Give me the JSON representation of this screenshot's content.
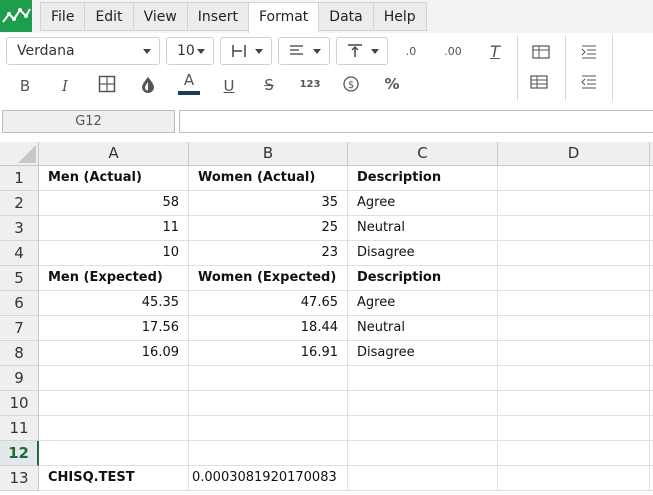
{
  "menu": [
    "File",
    "Edit",
    "View",
    "Insert",
    "Format",
    "Data",
    "Help"
  ],
  "active_menu": "Format",
  "toolbar": {
    "font_name": "Verdana",
    "font_size": "10",
    "bold_label": "B",
    "italic_label": "I",
    "text_color_label": "A",
    "underline_label": "U",
    "strike_label": "S",
    "number_format_label": "123",
    "percent_label": "%",
    "clear_format_label": "T",
    "decrease_decimal_label": ".0",
    "increase_decimal_label": ".00"
  },
  "name_box": "G12",
  "formula": "",
  "columns": [
    "A",
    "B",
    "C",
    "D"
  ],
  "rows": [
    "1",
    "2",
    "3",
    "4",
    "5",
    "6",
    "7",
    "8",
    "9",
    "10",
    "11",
    "12",
    "13"
  ],
  "selected_row": "12",
  "cells": {
    "A1": "Men (Actual)",
    "B1": "Women (Actual)",
    "C1": "Description",
    "A2": "58",
    "B2": "35",
    "C2": "Agree",
    "A3": "11",
    "B3": "25",
    "C3": "Neutral",
    "A4": "10",
    "B4": "23",
    "C4": "Disagree",
    "A5": "Men (Expected)",
    "B5": "Women (Expected)",
    "C5": "Description",
    "A6": "45.35",
    "B6": "47.65",
    "C6": "Agree",
    "A7": "17.56",
    "B7": "18.44",
    "C7": "Neutral",
    "A8": "16.09",
    "B8": "16.91",
    "C8": "Disagree",
    "A13": "CHISQ.TEST",
    "B13": "0.0003081920170083"
  },
  "colors": {
    "brand": "#1e9e4c",
    "selection": "#1b6d3a",
    "text_color_bar": "#1f3a5a"
  }
}
